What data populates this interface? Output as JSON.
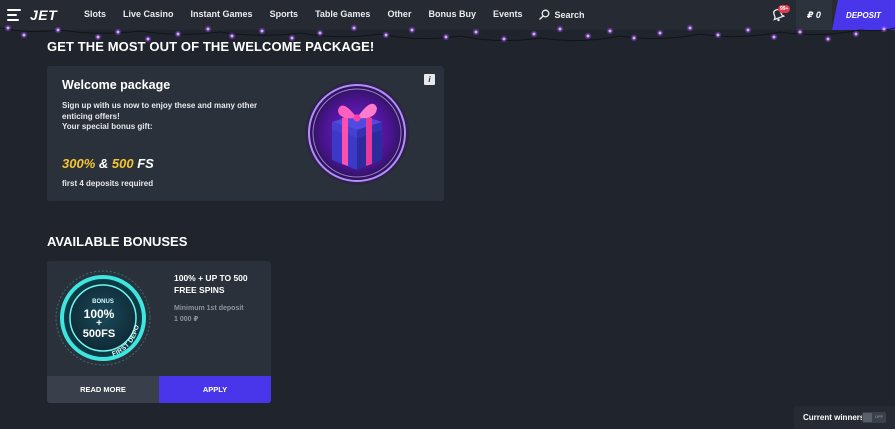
{
  "header": {
    "logo": "JET",
    "nav": [
      "Slots",
      "Live Casino",
      "Instant Games",
      "Sports",
      "Table Games",
      "Other",
      "Bonus Buy",
      "Events"
    ],
    "search_label": "Search",
    "notification_count": "99+",
    "balance": "₽ 0",
    "deposit_label": "DEPOSIT"
  },
  "welcome": {
    "heading": "GET THE MOST OUT OF THE WELCOME PACKAGE!",
    "card_title": "Welcome package",
    "description": "Sign up with us now to enjoy these and many other enticing offers!",
    "gift_label": "Your special bonus gift:",
    "offer_percent": "300%",
    "offer_amp": "&",
    "offer_fs_value": "500",
    "offer_fs_unit": "FS",
    "requirement": "first 4 deposits required",
    "info_icon_label": "i"
  },
  "bonuses": {
    "heading": "AVAILABLE BONUSES",
    "items": [
      {
        "title": "100% + UP TO 500 FREE SPINS",
        "min_label": "Minimum 1st deposit",
        "min_amount": "1 000 ₽",
        "badge_top": "BONUS",
        "badge_line1": "100%",
        "badge_plus": "+",
        "badge_line2": "500FS",
        "badge_ring": "FIRST DEPOSIT",
        "read_more_label": "READ MORE",
        "apply_label": "APPLY"
      }
    ]
  },
  "footer": {
    "winners_label": "Current winners",
    "toggle_label": "OFF"
  },
  "colors": {
    "background": "#20252d",
    "card": "#2b313b",
    "accent": "#4a36ea",
    "gold": "#f5c530",
    "garland_light": "#a64dff"
  },
  "icons": [
    "menu-icon",
    "search-icon",
    "bell-icon",
    "info-icon",
    "gift-icon"
  ]
}
